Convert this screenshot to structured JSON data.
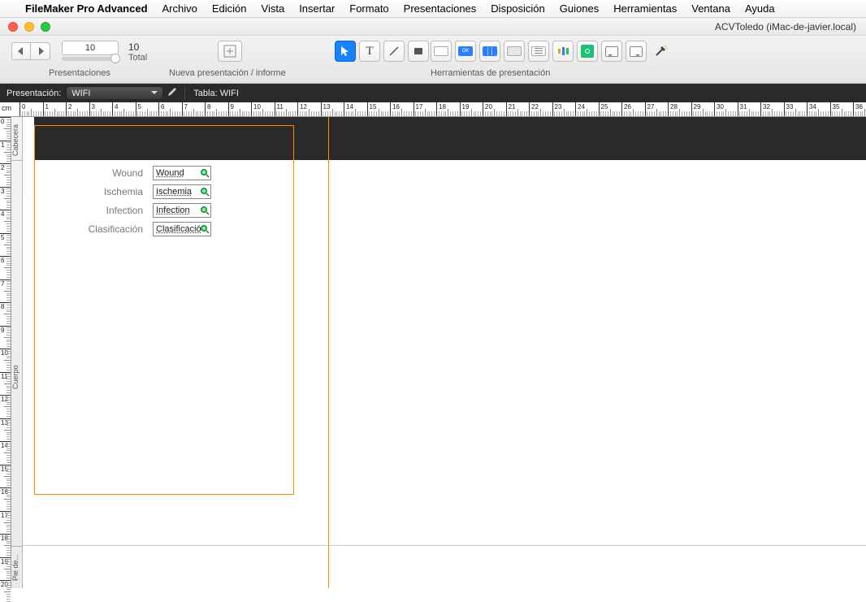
{
  "menubar": {
    "app": "FileMaker Pro Advanced",
    "items": [
      "Archivo",
      "Edición",
      "Vista",
      "Insertar",
      "Formato",
      "Presentaciones",
      "Disposición",
      "Guiones",
      "Herramientas",
      "Ventana",
      "Ayuda"
    ]
  },
  "window": {
    "title": "ACVToledo (iMac-de-javier.local)"
  },
  "toolbar": {
    "record_number": "10",
    "total_count": "10",
    "total_label": "Total",
    "label_presentaciones": "Presentaciones",
    "label_nueva": "Nueva presentación / informe",
    "label_herramientas": "Herramientas de presentación"
  },
  "subbar": {
    "label": "Presentación:",
    "layout_name": "WIFI",
    "tabla_label": "Tabla:",
    "tabla_name": "WIFI"
  },
  "ruler_unit": "cm",
  "parts": {
    "header": "Cabecera",
    "body": "Cuerpo",
    "footer": "Pie de..."
  },
  "fields": [
    {
      "label": "Wound",
      "value": "Wound"
    },
    {
      "label": "Ischemia",
      "value": "Ischemia"
    },
    {
      "label": "Infection",
      "value": "Infection"
    },
    {
      "label": "Clasificación",
      "value": "Clasificació"
    }
  ]
}
